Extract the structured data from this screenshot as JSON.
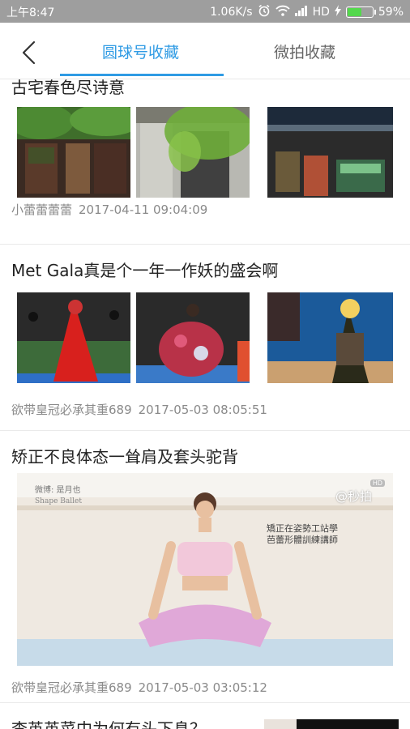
{
  "status_bar": {
    "time": "上午8:47",
    "speed": "1.06K/s",
    "network": "HD",
    "battery": "59%",
    "battery_level": 0.59
  },
  "header": {
    "back_icon": "chevron-left-icon",
    "tabs": [
      {
        "label": "圆球号收藏",
        "active": true
      },
      {
        "label": "微拍收藏",
        "active": false
      }
    ],
    "accent_color": "#2f9be4"
  },
  "posts": [
    {
      "title": "古宅春色尽诗意",
      "author": "小蕾蕾蕾蕾",
      "time": "2017-04-11 09:04:09"
    },
    {
      "title": "Met Gala真是个一年一作妖的盛会啊",
      "author": "欲带皇冠必承其重689",
      "time": "2017-05-03 08:05:51"
    },
    {
      "title": "矫正不良体态一耸肩及套头驼背",
      "author": "欲带皇冠必承其重689",
      "time": "2017-05-03 03:05:12",
      "video": {
        "watermark_left_1": "微博: 是月也",
        "watermark_left_2": "Shape Ballet",
        "watermark_right": "@秒拍",
        "hd_badge": "HD",
        "overlay_text_1": "矯正在姿勢工站學",
        "overlay_text_2": "芭蕾形體訓練講師"
      }
    },
    {
      "title": "李英英菜中为何有头下息？"
    }
  ]
}
